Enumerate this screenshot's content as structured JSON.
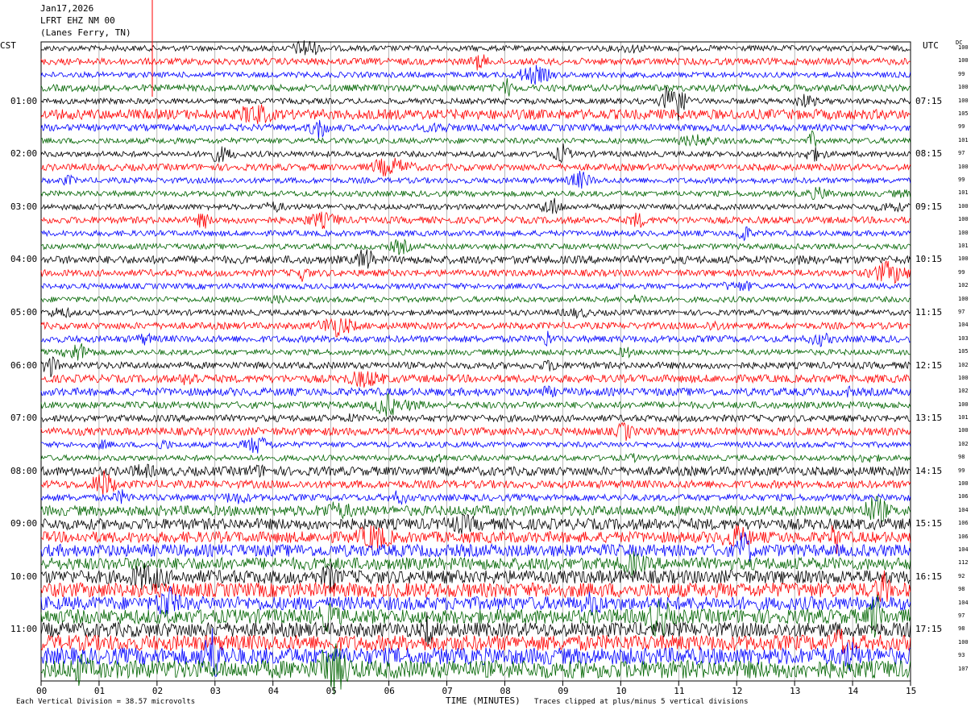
{
  "header": {
    "date": "Jan17,2026",
    "station": "LFRT EHZ NM 00",
    "location": "(Lanes Ferry, TN)",
    "left_tz": "CST",
    "right_tz": "UTC",
    "dc_heading": "DC"
  },
  "footer": {
    "scale_note": "Each Vertical Division = 38.57 microvolts",
    "xlabel": "TIME (MINUTES)",
    "clip_note": "Traces clipped at plus/minus 5 vertical divisions"
  },
  "chart_data": {
    "type": "line",
    "title": "LFRT EHZ NM 00 (Lanes Ferry, TN) Jan17,2026",
    "xlabel": "TIME (MINUTES)",
    "xlim": [
      0,
      15
    ],
    "x_ticks": [
      "00",
      "01",
      "02",
      "03",
      "04",
      "05",
      "06",
      "07",
      "08",
      "09",
      "10",
      "11",
      "12",
      "13",
      "14",
      "15"
    ],
    "trace_colors": [
      "#000000",
      "#ff0000",
      "#0000ff",
      "#006400"
    ],
    "trace_count": 48,
    "minutes_per_trace": 15,
    "left_hour_labels": [
      "01:00",
      "02:00",
      "03:00",
      "04:00",
      "05:00",
      "06:00",
      "07:00",
      "08:00",
      "09:00",
      "10:00",
      "11:00"
    ],
    "right_hour_labels": [
      "07:15",
      "08:15",
      "09:15",
      "10:15",
      "11:15",
      "12:15",
      "13:15",
      "14:15",
      "15:15",
      "16:15",
      "17:15"
    ],
    "dc_offsets": [
      "100",
      "100",
      "99",
      "100",
      "100",
      "105",
      "99",
      "101",
      "97",
      "100",
      "99",
      "101",
      "100",
      "100",
      "100",
      "101",
      "100",
      "99",
      "102",
      "100",
      "97",
      "104",
      "103",
      "105",
      "102",
      "100",
      "102",
      "100",
      "101",
      "100",
      "102",
      "98",
      "99",
      "100",
      "106",
      "104",
      "106",
      "106",
      "104",
      "112",
      "92",
      "98",
      "104",
      "97",
      "98",
      "100",
      "93",
      "107"
    ],
    "amplitude_profile": [
      0.5,
      0.6,
      0.5,
      0.6,
      0.5,
      0.9,
      0.6,
      0.5,
      0.5,
      0.6,
      0.5,
      0.5,
      0.5,
      0.6,
      0.5,
      0.5,
      0.7,
      0.6,
      0.5,
      0.5,
      0.5,
      0.6,
      0.6,
      0.5,
      0.6,
      0.7,
      0.7,
      0.6,
      0.6,
      0.7,
      0.5,
      0.5,
      0.8,
      0.7,
      0.6,
      0.9,
      1.0,
      1.0,
      1.1,
      1.1,
      1.2,
      1.3,
      1.2,
      1.3,
      1.3,
      1.4,
      1.5,
      1.6
    ]
  }
}
